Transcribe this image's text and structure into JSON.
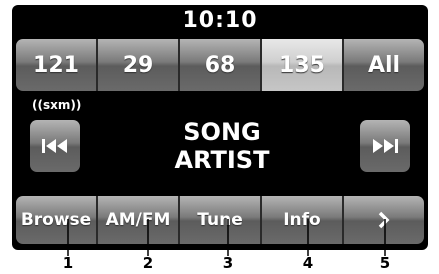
{
  "clock": "10:10",
  "presets": [
    {
      "label": "121",
      "active": false
    },
    {
      "label": "29",
      "active": false
    },
    {
      "label": "68",
      "active": false
    },
    {
      "label": "135",
      "active": true
    },
    {
      "label": "All",
      "active": false
    }
  ],
  "source_logo": "((sxm))",
  "now_playing": {
    "song": "SONG",
    "artist": "ARTIST"
  },
  "controls": {
    "prev_icon": "skip-previous-icon",
    "next_icon": "skip-next-icon"
  },
  "softkeys": [
    "Browse",
    "AM/FM",
    "Tune",
    "Info"
  ],
  "softkey_more_icon": "chevron-right-icon",
  "callouts": [
    "1",
    "2",
    "3",
    "4",
    "5"
  ]
}
